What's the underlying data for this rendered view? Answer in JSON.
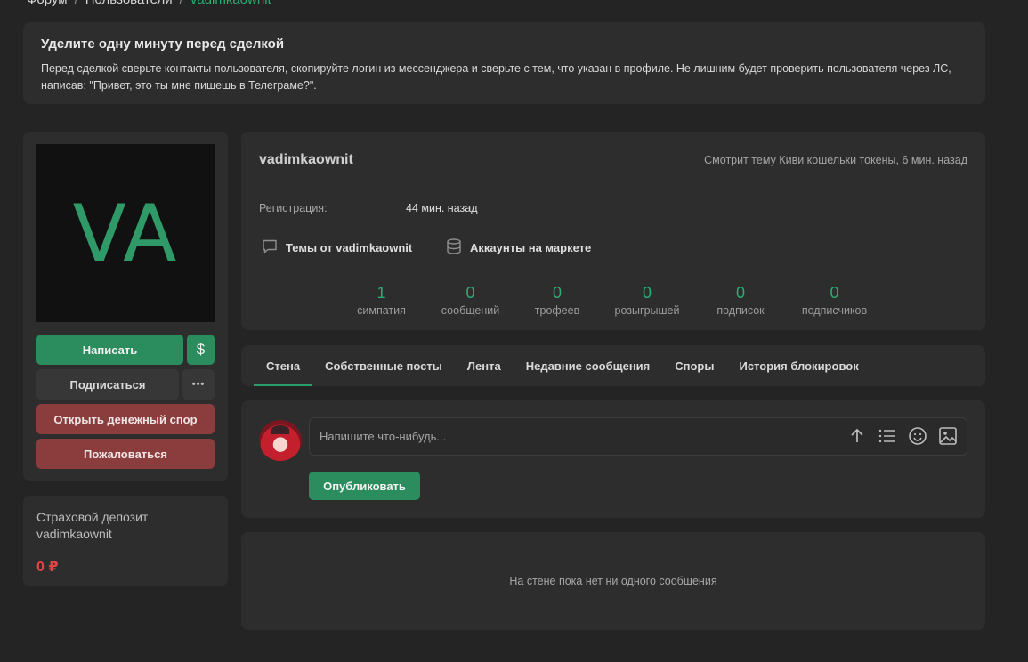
{
  "breadcrumb": {
    "items": [
      "Форум",
      "Пользователи"
    ],
    "current": "vadimkaownit"
  },
  "notice": {
    "title": "Уделите одну минуту перед сделкой",
    "text": "Перед сделкой сверьте контакты пользователя, скопируйте логин из мессенджера и сверьте с тем, что указан в профиле. Не лишним будет проверить пользователя через ЛС, написав: \"Привет, это ты мне пишешь в Телеграме?\"."
  },
  "profile": {
    "avatar_initials": "VA",
    "username": "vadimkaownit",
    "activity": "Смотрит тему Киви кошельки токены, 6 мин. назад",
    "registration_label": "Регистрация:",
    "registration_value": "44 мин. назад",
    "topics_link": "Темы от vadimkaownit",
    "market_link": "Аккаунты на маркете"
  },
  "actions": {
    "write": "Написать",
    "money_icon": "$",
    "subscribe": "Подписаться",
    "more_icon": "•••",
    "open_dispute": "Открыть денежный спор",
    "report": "Пожаловаться"
  },
  "deposit": {
    "title": "Страховой депозит vadimkaownit",
    "value": "0 ₽"
  },
  "stats": [
    {
      "value": "1",
      "label": "симпатия"
    },
    {
      "value": "0",
      "label": "сообщений"
    },
    {
      "value": "0",
      "label": "трофеев"
    },
    {
      "value": "0",
      "label": "розыгрышей"
    },
    {
      "value": "0",
      "label": "подписок"
    },
    {
      "value": "0",
      "label": "подписчиков"
    }
  ],
  "tabs": [
    {
      "label": "Стена",
      "active": true
    },
    {
      "label": "Собственные посты"
    },
    {
      "label": "Лента"
    },
    {
      "label": "Недавние сообщения"
    },
    {
      "label": "Споры"
    },
    {
      "label": "История блокировок"
    }
  ],
  "composer": {
    "placeholder": "Напишите что-нибудь...",
    "publish": "Опубликовать"
  },
  "wall": {
    "empty_text": "На стене пока нет ни одного сообщения"
  },
  "colors": {
    "accent_green": "#2bad72",
    "button_green": "#2b8c5e",
    "button_red": "#8b3c3c",
    "deposit_red": "#e04646"
  }
}
